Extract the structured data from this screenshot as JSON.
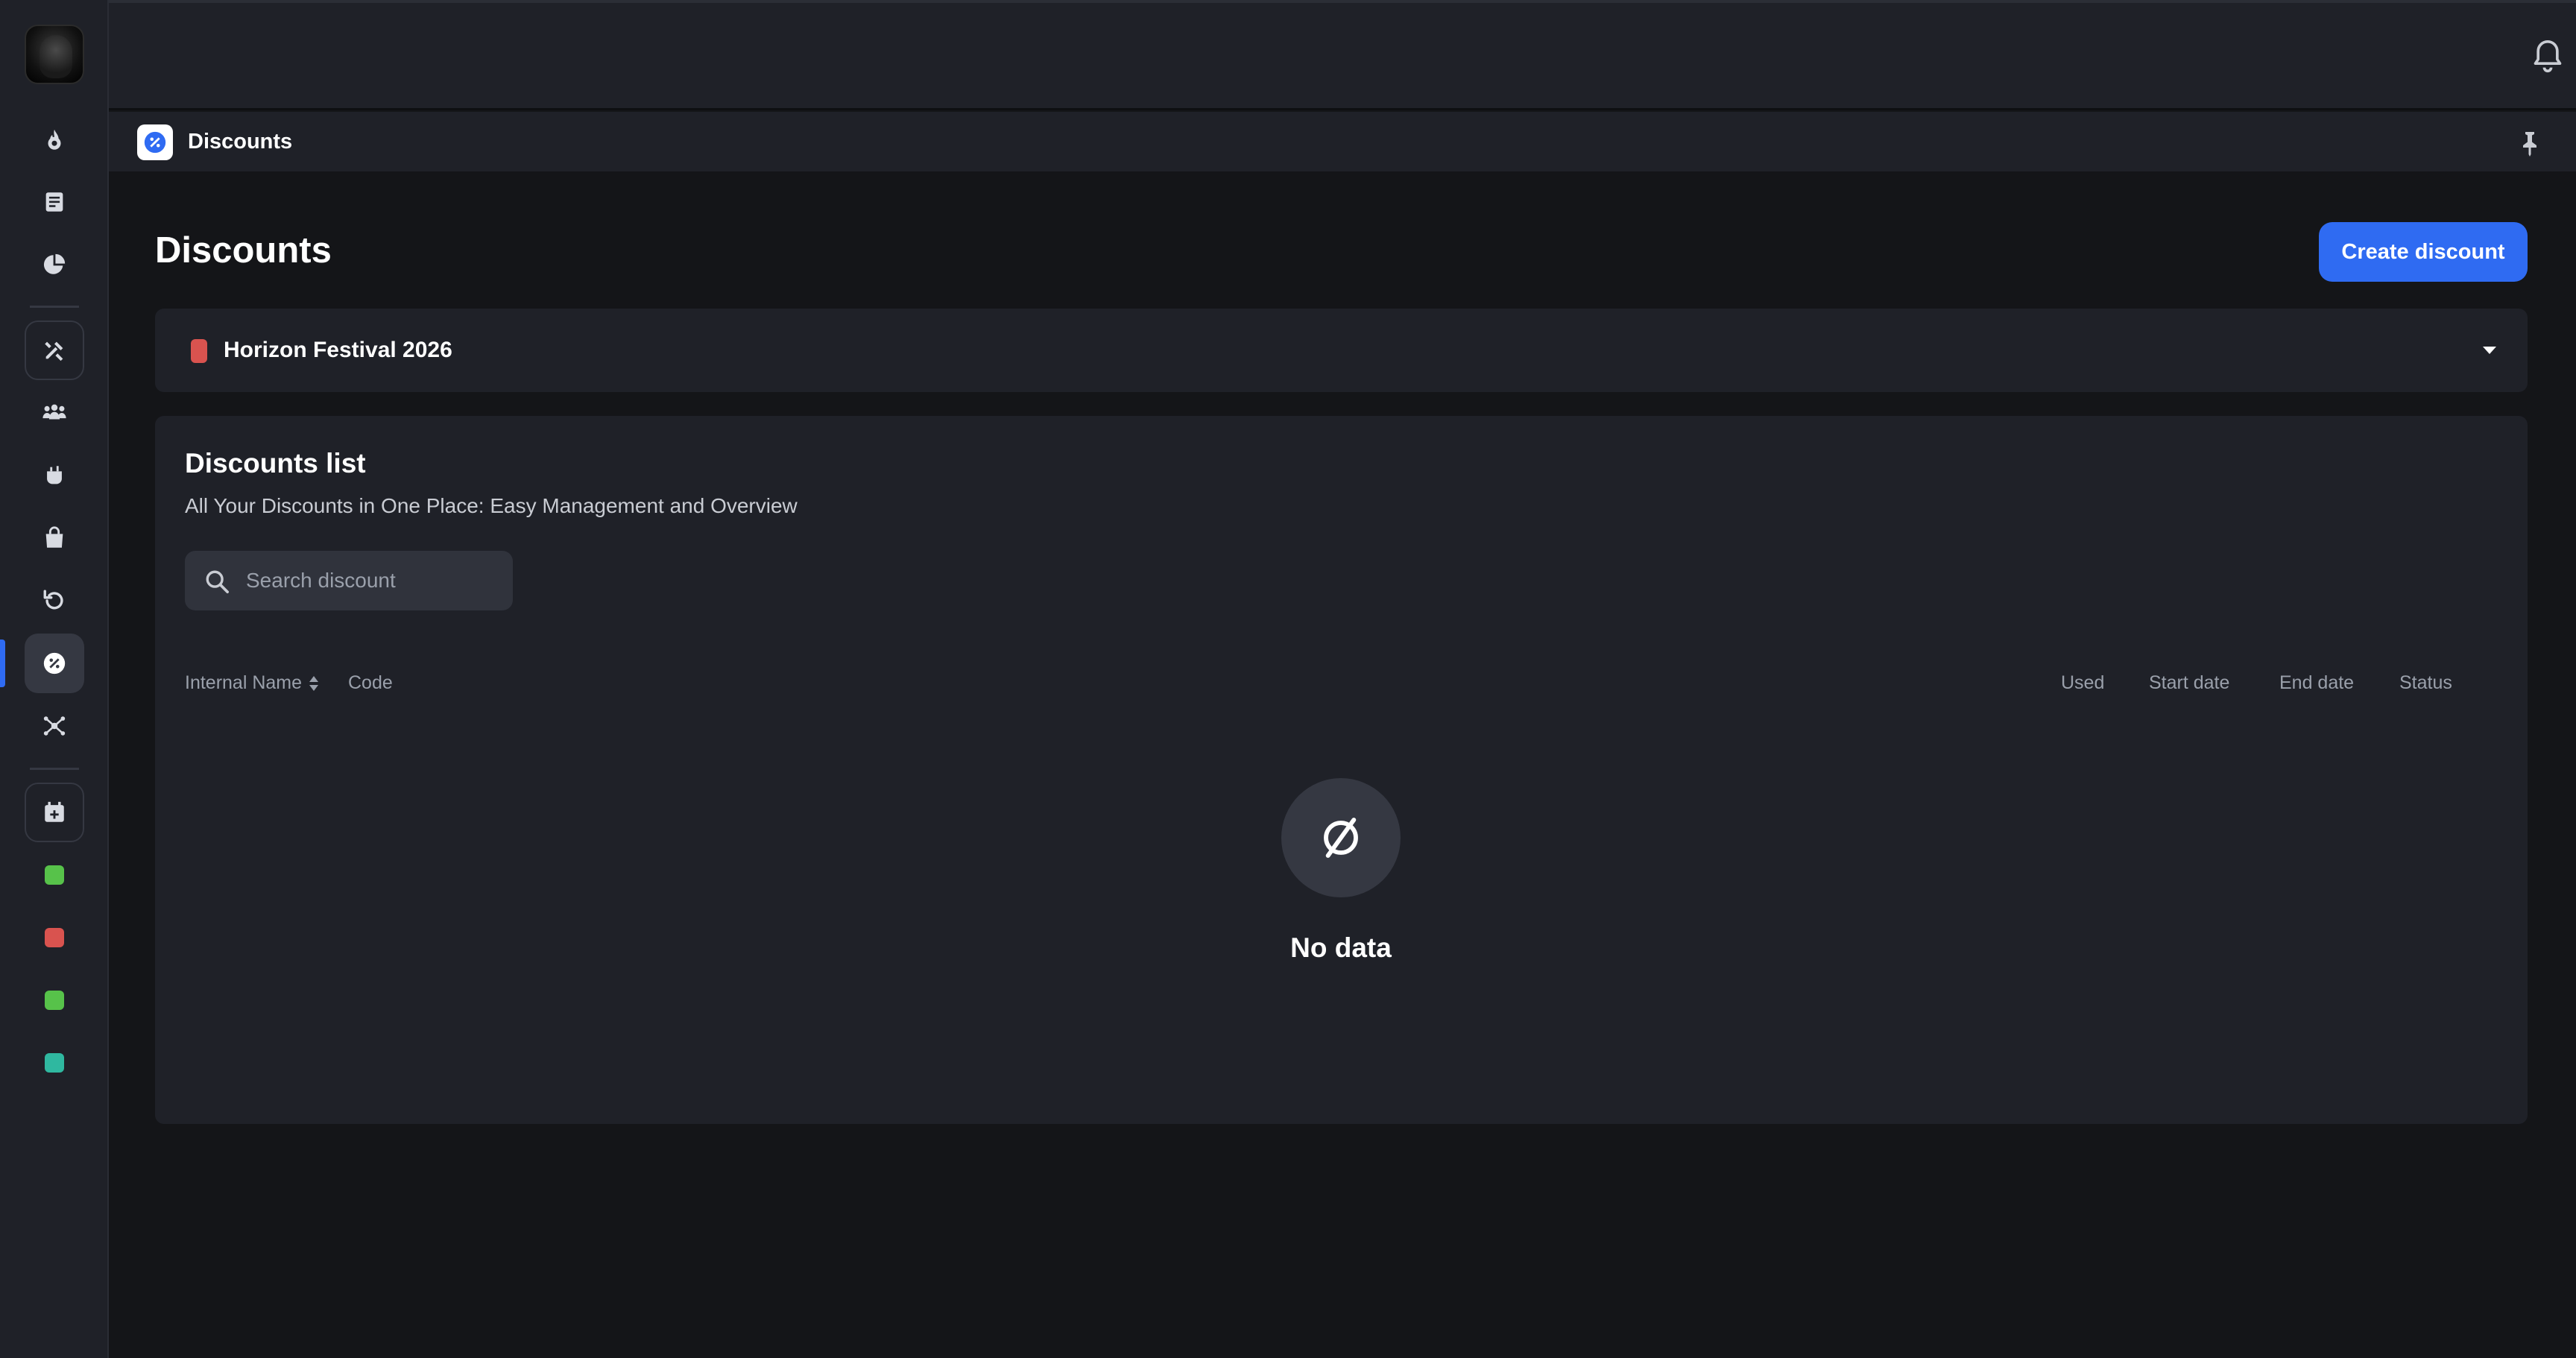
{
  "header": {
    "notifications_icon": "bell-icon",
    "profile_icon": "brand-v-logo"
  },
  "breadcrumb": {
    "icon": "discount-badge-icon",
    "title": "Discounts",
    "pin_icon": "pin-icon"
  },
  "sidebar": {
    "items": [
      {
        "icon": "flame-icon"
      },
      {
        "icon": "receipt-icon"
      },
      {
        "icon": "pie-chart-icon"
      },
      {
        "icon": "tools-icon"
      },
      {
        "icon": "users-icon"
      },
      {
        "icon": "cocktail-icon"
      },
      {
        "icon": "shopping-bag-icon"
      },
      {
        "icon": "undo-icon"
      },
      {
        "icon": "discount-badge-icon",
        "active": true
      },
      {
        "icon": "network-icon"
      },
      {
        "icon": "calendar-add-icon"
      }
    ],
    "events": [
      {
        "color": "#57c24a"
      },
      {
        "color": "#d9534f"
      },
      {
        "color": "#57c24a"
      },
      {
        "color": "#2fb8a0"
      }
    ]
  },
  "main": {
    "title": "Discounts",
    "create_button_label": "Create discount",
    "event_select": {
      "selected": "Horizon Festival 2026",
      "color": "#d9534f"
    },
    "list": {
      "title": "Discounts list",
      "subtitle": "All Your Discounts in One Place: Easy Management and Overview",
      "search_placeholder": "Search discount",
      "columns": [
        "Internal Name",
        "Code",
        "Used",
        "Start date",
        "End date",
        "Status"
      ],
      "rows": [],
      "empty_text": "No data"
    }
  },
  "colors": {
    "accent": "#2f6bf2",
    "background": "#141518",
    "surface": "#1f2128"
  }
}
